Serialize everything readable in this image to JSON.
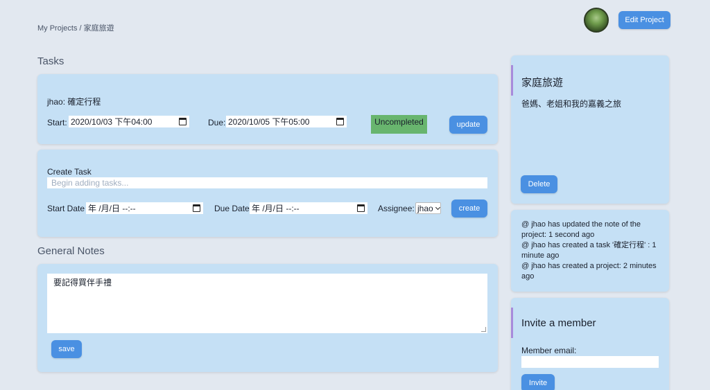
{
  "header": {
    "breadcrumb": "My Projects / 家庭旅遊",
    "edit_project_label": "Edit Project"
  },
  "tasks": {
    "section_title": "Tasks",
    "items": [
      {
        "title": "jhao: 確定行程",
        "start_label": "Start:",
        "start_value": "2020/10/03 下午04:00",
        "due_label": "Due:",
        "due_value": "2020/10/05 下午05:00",
        "status": "Uncompleted",
        "update_label": "update"
      }
    ]
  },
  "create_task": {
    "title": "Create Task",
    "placeholder": "Begin adding tasks...",
    "start_date_label": "Start Date",
    "start_date_value": "年 /月/日 --:--",
    "due_date_label": "Due Date",
    "due_date_value": "年 /月/日 --:--",
    "assignee_label": "Assignee:",
    "assignee_value": "jhao",
    "create_label": "create"
  },
  "notes": {
    "section_title": "General Notes",
    "content": "要記得買伴手禮",
    "save_label": "save"
  },
  "project": {
    "name": "家庭旅遊",
    "description": "爸媽、老姐和我的嘉義之旅",
    "delete_label": "Delete"
  },
  "activity": [
    "@ jhao has updated the note of the project: 1 second ago",
    "@ jhao has created a task '確定行程' : 1 minute ago",
    "@ jhao has created a project: 2 minutes ago"
  ],
  "invite": {
    "title": "Invite a member",
    "email_label": "Member email:",
    "email_value": "",
    "invite_label": "Invite"
  },
  "colors": {
    "background": "#e2e8f0",
    "card": "#c5e0f5",
    "button": "#4a90e2",
    "status_uncompleted": "#68b56e",
    "accent": "#a78bdb"
  }
}
